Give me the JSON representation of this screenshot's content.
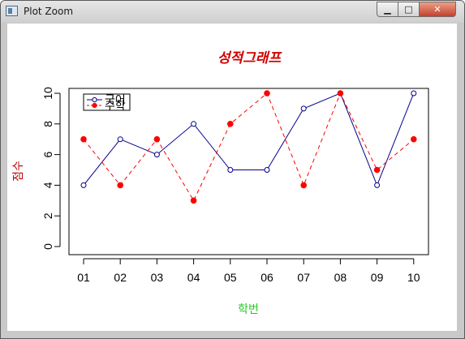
{
  "window": {
    "title": "Plot Zoom",
    "minimize_glyph": "▁",
    "maximize_glyph": "□",
    "close_glyph": "✕"
  },
  "chart_data": {
    "type": "line",
    "title": "성적그래프",
    "xlabel": "학번",
    "ylabel": "점수",
    "categories": [
      "01",
      "02",
      "03",
      "04",
      "05",
      "06",
      "07",
      "08",
      "09",
      "10"
    ],
    "ylim": [
      0,
      10
    ],
    "yticks": [
      0,
      2,
      4,
      6,
      8,
      10
    ],
    "grid": false,
    "legend_position": "top-left",
    "series": [
      {
        "name": "국어",
        "values": [
          4,
          7,
          6,
          8,
          5,
          5,
          9,
          10,
          4,
          10
        ],
        "color": "#00008b",
        "line_style": "solid",
        "marker": "open-circle"
      },
      {
        "name": "수학",
        "values": [
          7,
          4,
          7,
          3,
          8,
          10,
          4,
          10,
          5,
          7
        ],
        "color": "#ff0000",
        "line_style": "dashed",
        "marker": "filled-circle"
      }
    ],
    "colors": {
      "title": "#d00000",
      "xlabel": "#22cc22",
      "ylabel": "#c00000"
    }
  }
}
